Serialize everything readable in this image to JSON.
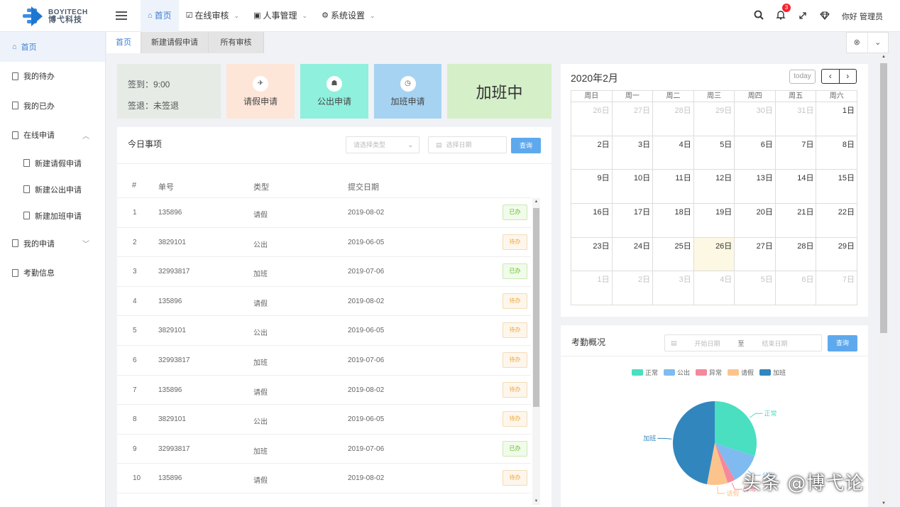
{
  "logo": {
    "en": "BOYITECH",
    "cn": "博弋科技"
  },
  "topnav": [
    {
      "label": "首页",
      "icon": "home-icon",
      "glyph": "⌂"
    },
    {
      "label": "在线审核",
      "icon": "checkbox-icon",
      "glyph": "☑"
    },
    {
      "label": "人事管理",
      "icon": "user-card-icon",
      "glyph": "▣"
    },
    {
      "label": "系统设置",
      "icon": "gear-icon",
      "glyph": "⚙"
    }
  ],
  "topright": {
    "badge": "3",
    "greeting": "你好 管理员"
  },
  "sidebar": [
    {
      "label": "首页"
    },
    {
      "label": "我的待办"
    },
    {
      "label": "我的已办"
    },
    {
      "label": "在线申请"
    },
    {
      "label": "新建请假申请"
    },
    {
      "label": "新建公出申请"
    },
    {
      "label": "新建加班申请"
    },
    {
      "label": "我的申请"
    },
    {
      "label": "考勤信息"
    }
  ],
  "tabs": [
    "首页",
    "新建请假申请",
    "所有审核"
  ],
  "sign": {
    "in": "签到：9:00",
    "out": "签退：未签退"
  },
  "quick": [
    {
      "label": "请假申请",
      "color": "#fde6d8",
      "glyph": "✈"
    },
    {
      "label": "公出申请",
      "color": "#8ef0dd",
      "glyph": "☗"
    },
    {
      "label": "加班申请",
      "color": "#a6d3f2",
      "glyph": "◷"
    }
  ],
  "overtime": "加班中",
  "today": {
    "title": "今日事项",
    "type_placeholder": "请选择类型",
    "date_placeholder": "选择日期",
    "query": "查询",
    "headers": [
      "#",
      "单号",
      "类型",
      "提交日期"
    ],
    "rows": [
      {
        "no": "1",
        "id": "135896",
        "type": "请假",
        "date": "2019-08-02",
        "status": "已办",
        "done": true
      },
      {
        "no": "2",
        "id": "3829101",
        "type": "公出",
        "date": "2019-06-05",
        "status": "待办",
        "done": false
      },
      {
        "no": "3",
        "id": "32993817",
        "type": "加班",
        "date": "2019-07-06",
        "status": "已办",
        "done": true
      },
      {
        "no": "4",
        "id": "135896",
        "type": "请假",
        "date": "2019-08-02",
        "status": "待办",
        "done": false
      },
      {
        "no": "5",
        "id": "3829101",
        "type": "公出",
        "date": "2019-06-05",
        "status": "待办",
        "done": false
      },
      {
        "no": "6",
        "id": "32993817",
        "type": "加班",
        "date": "2019-07-06",
        "status": "待办",
        "done": false
      },
      {
        "no": "7",
        "id": "135896",
        "type": "请假",
        "date": "2019-08-02",
        "status": "待办",
        "done": false
      },
      {
        "no": "8",
        "id": "3829101",
        "type": "公出",
        "date": "2019-06-05",
        "status": "待办",
        "done": false
      },
      {
        "no": "9",
        "id": "32993817",
        "type": "加班",
        "date": "2019-07-06",
        "status": "已办",
        "done": true
      },
      {
        "no": "10",
        "id": "135896",
        "type": "请假",
        "date": "2019-08-02",
        "status": "待办",
        "done": false
      }
    ]
  },
  "calendar": {
    "title": "2020年2月",
    "today_btn": "today",
    "weekdays": [
      "周日",
      "周一",
      "周二",
      "周三",
      "周四",
      "周五",
      "周六"
    ],
    "weeks": [
      [
        "26日",
        "27日",
        "28日",
        "29日",
        "30日",
        "31日",
        "1日"
      ],
      [
        "2日",
        "3日",
        "4日",
        "5日",
        "6日",
        "7日",
        "8日"
      ],
      [
        "9日",
        "10日",
        "11日",
        "12日",
        "13日",
        "14日",
        "15日"
      ],
      [
        "16日",
        "17日",
        "18日",
        "19日",
        "20日",
        "21日",
        "22日"
      ],
      [
        "23日",
        "24日",
        "25日",
        "26日",
        "27日",
        "28日",
        "29日"
      ],
      [
        "1日",
        "2日",
        "3日",
        "4日",
        "5日",
        "6日",
        "7日"
      ]
    ],
    "current": "26日"
  },
  "attendance": {
    "title": "考勤概况",
    "start_placeholder": "开始日期",
    "sep": "至",
    "end_placeholder": "结束日期",
    "query": "查询"
  },
  "chart_data": {
    "type": "pie",
    "series": [
      {
        "name": "正常",
        "value": 30,
        "color": "#49dfc0"
      },
      {
        "name": "公出",
        "value": 12,
        "color": "#7fbbf0"
      },
      {
        "name": "异常",
        "value": 3,
        "color": "#f5889c"
      },
      {
        "name": "请假",
        "value": 8,
        "color": "#fbc48d"
      },
      {
        "name": "加班",
        "value": 47,
        "color": "#3286be"
      }
    ],
    "legend": "top"
  },
  "watermark": "头条 @博弋论"
}
